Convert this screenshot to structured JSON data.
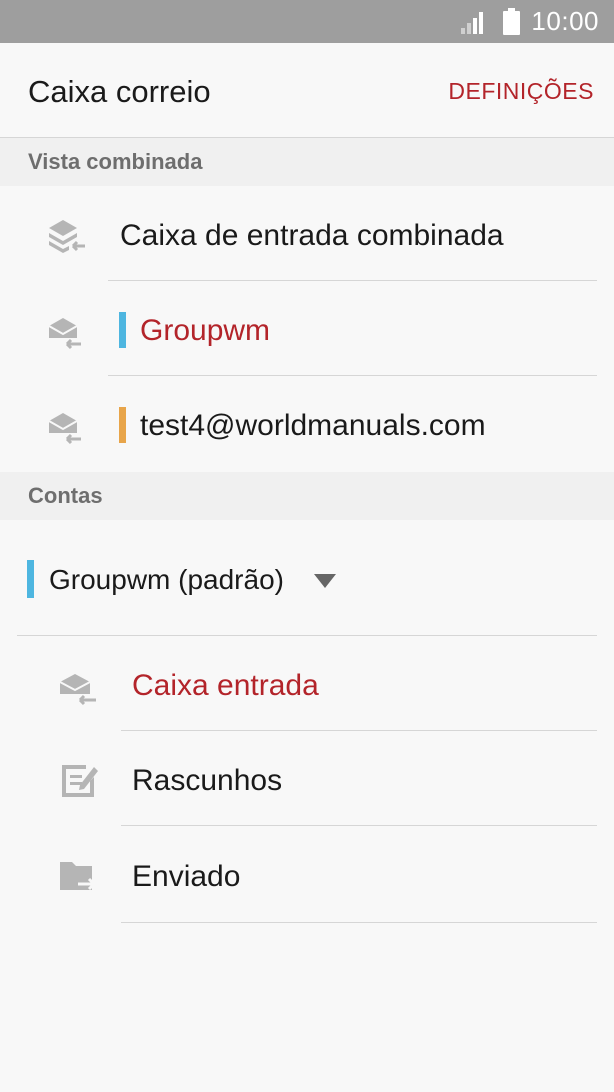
{
  "status_bar": {
    "time": "10:00"
  },
  "header": {
    "title": "Caixa correio",
    "settings_label": "DEFINIÇÕES"
  },
  "sections": {
    "combined": "Vista combinada",
    "accounts": "Contas"
  },
  "combined_items": [
    {
      "label": "Caixa de entrada combinada",
      "highlighted": false
    },
    {
      "label": "Groupwm",
      "highlighted": true,
      "bar_color": "#4eb6e0"
    },
    {
      "label": "test4@worldmanuals.com",
      "highlighted": false,
      "bar_color": "#e8a54a"
    }
  ],
  "account": {
    "label": "Groupwm (padrão)",
    "bar_color": "#4eb6e0"
  },
  "folders": [
    {
      "label": "Caixa entrada",
      "icon": "inbox-icon",
      "highlighted": true
    },
    {
      "label": "Rascunhos",
      "icon": "drafts-icon",
      "highlighted": false
    },
    {
      "label": "Enviado",
      "icon": "sent-folder-icon",
      "highlighted": false
    }
  ],
  "colors": {
    "accent": "#b3242a",
    "icon": "#b5b5b5"
  }
}
